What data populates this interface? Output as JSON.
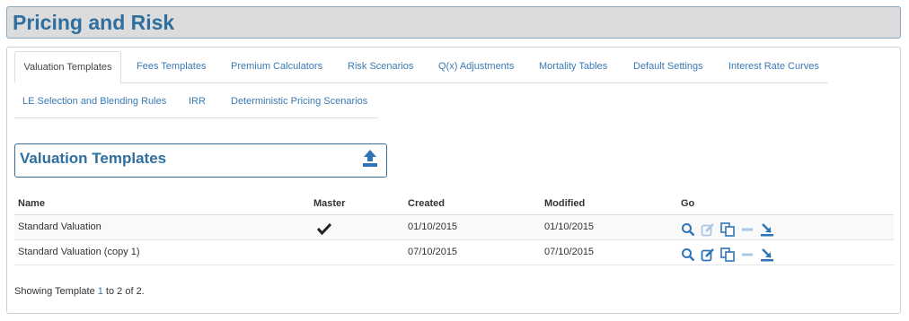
{
  "page": {
    "title": "Pricing and Risk"
  },
  "tabs_row1": [
    {
      "label": "Valuation Templates",
      "active": true
    },
    {
      "label": "Fees Templates"
    },
    {
      "label": "Premium Calculators"
    },
    {
      "label": "Risk Scenarios"
    },
    {
      "label": "Q(x) Adjustments"
    },
    {
      "label": "Mortality Tables"
    },
    {
      "label": "Default Settings"
    },
    {
      "label": "Interest Rate Curves"
    }
  ],
  "tabs_row2": [
    {
      "label": "LE Selection and Blending Rules"
    },
    {
      "label": "IRR"
    },
    {
      "label": "Deterministic Pricing Scenarios"
    }
  ],
  "section": {
    "title": "Valuation Templates"
  },
  "table": {
    "headers": {
      "name": "Name",
      "master": "Master",
      "created": "Created",
      "modified": "Modified",
      "go": "Go"
    },
    "rows": [
      {
        "name": "Standard Valuation",
        "master": "✔",
        "created": "01/10/2015",
        "modified": "01/10/2015"
      },
      {
        "name": "Standard Valuation (copy 1)",
        "master": "",
        "created": "07/10/2015",
        "modified": "07/10/2015"
      }
    ]
  },
  "footer": {
    "prefix": "Showing Template ",
    "start": "1",
    "middle": " to 2 of 2."
  },
  "colors": {
    "accent": "#3a7ab3",
    "title": "#2f6f9f",
    "icon": "#2e75b6",
    "icon_faded": "#a9c7e4"
  }
}
